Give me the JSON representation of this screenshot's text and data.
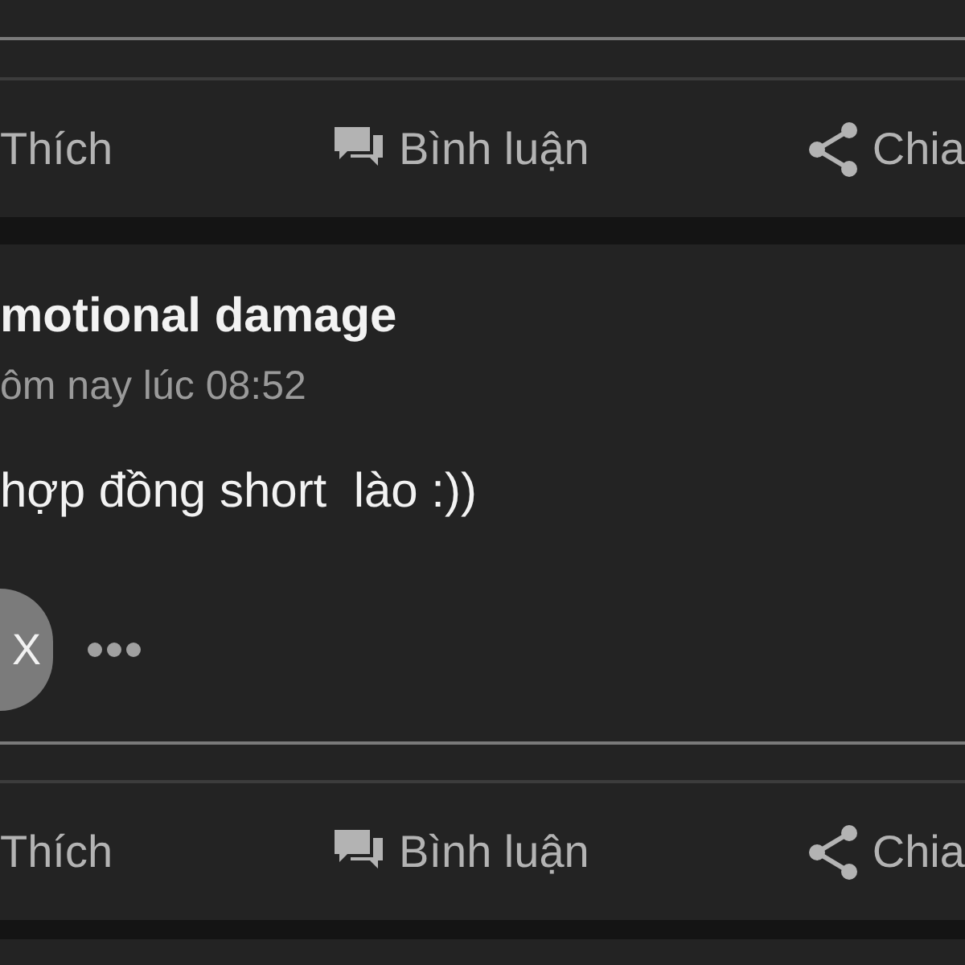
{
  "top_actions": [
    {
      "kind": "like",
      "label": "Thích"
    },
    {
      "kind": "comment",
      "label": "Bình luận"
    },
    {
      "kind": "share",
      "label": "Chia"
    }
  ],
  "post": {
    "author": "motional damage",
    "time": "ôm nay lúc 08:52",
    "text": "hợp đồng short  lào :))",
    "avatar": "X"
  },
  "bottom_actions": [
    {
      "kind": "like",
      "label": "Thích"
    },
    {
      "kind": "comment",
      "label": "Bình luận"
    },
    {
      "kind": "share",
      "label": "Chia"
    }
  ]
}
